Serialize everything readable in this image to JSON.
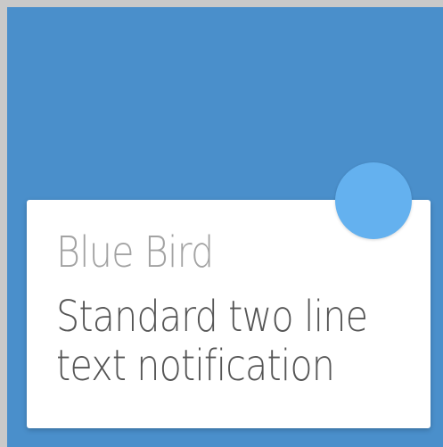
{
  "notification": {
    "title": "Blue Bird",
    "body_lines": [
      "Standard two line",
      "text notification"
    ]
  },
  "icon": {
    "name": "app-icon"
  },
  "colors": {
    "frame": "#c9c9c9",
    "background": "#4a8fcb",
    "card": "#ffffff",
    "app_icon": "#64b1ef",
    "title_text": "#a3a3a3",
    "body_text": "#555555"
  }
}
